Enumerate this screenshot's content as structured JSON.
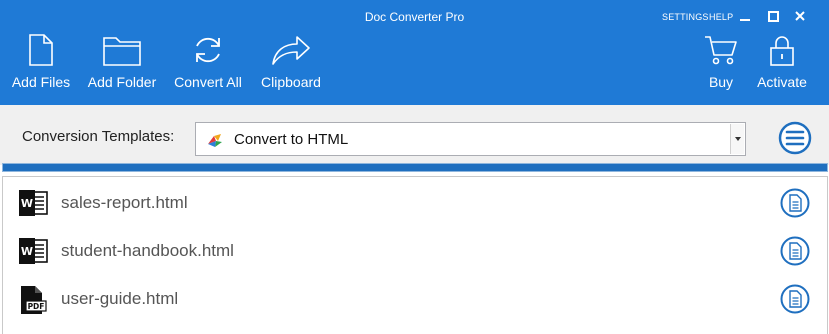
{
  "window": {
    "title": "Doc Converter Pro",
    "links": {
      "settings": "SETTINGS",
      "help": "HELP"
    },
    "controls": {
      "minimize_icon": "minimize-icon",
      "maximize_icon": "maximize-icon",
      "close_icon": "close-icon"
    }
  },
  "toolbar": {
    "add_files": "Add Files",
    "add_folder": "Add Folder",
    "convert_all": "Convert All",
    "clipboard": "Clipboard",
    "buy": "Buy",
    "activate": "Activate"
  },
  "templates": {
    "label": "Conversion Templates:",
    "selected": "Convert to HTML"
  },
  "progress": {
    "value": 0
  },
  "files": [
    {
      "name": "sales-report.html",
      "type": "word"
    },
    {
      "name": "student-handbook.html",
      "type": "word"
    },
    {
      "name": "user-guide.html",
      "type": "pdf"
    }
  ],
  "colors": {
    "header": "#1f7ad6",
    "accent": "#1f7ad6",
    "progress": "#1f6fbf"
  }
}
